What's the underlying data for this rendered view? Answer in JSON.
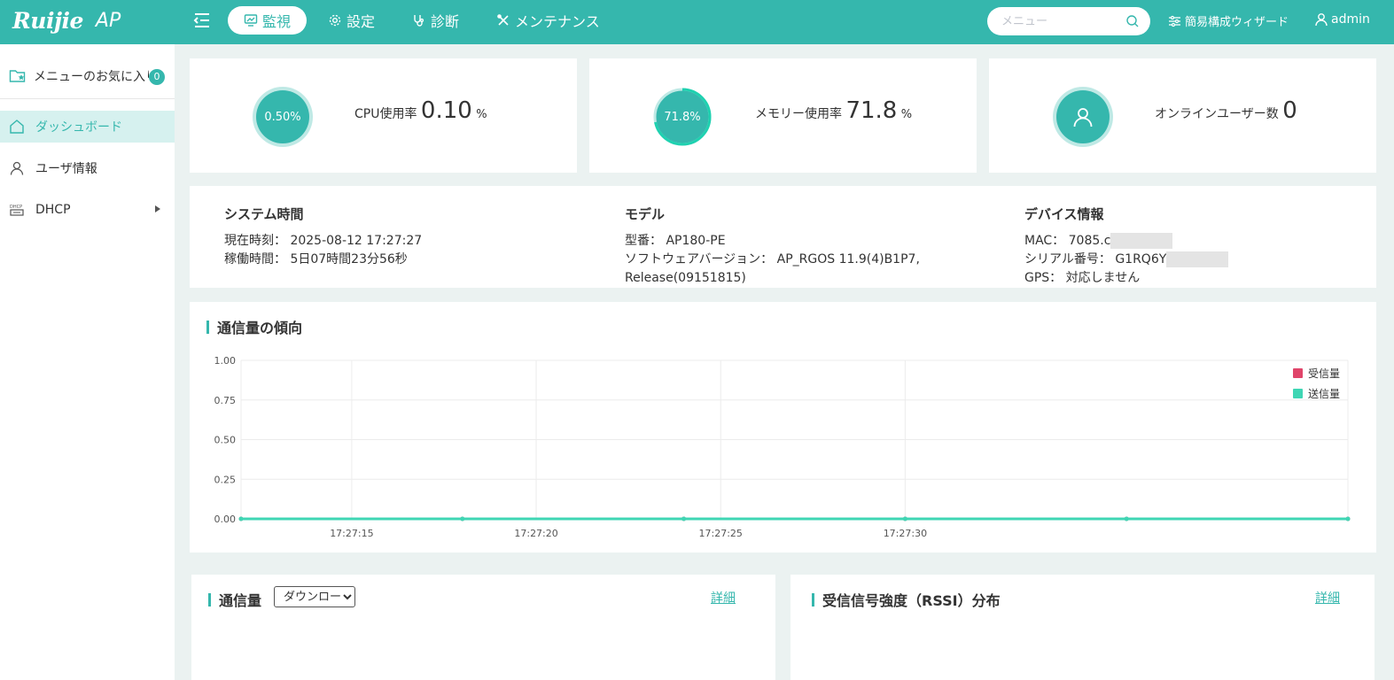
{
  "header": {
    "logo": "Ruijie",
    "product": "AP",
    "nav": [
      {
        "label": "監視",
        "icon": "monitor-icon",
        "active": true
      },
      {
        "label": "設定",
        "icon": "gear-icon",
        "active": false
      },
      {
        "label": "診断",
        "icon": "stethoscope-icon",
        "active": false
      },
      {
        "label": "メンテナンス",
        "icon": "tools-icon",
        "active": false
      }
    ],
    "search_placeholder": "メニュー",
    "wizard_label": "簡易構成ウィザード",
    "user_label": "admin"
  },
  "sidebar": {
    "favorites_label": "メニューのお気に入り",
    "favorites_count": "0",
    "items": [
      {
        "label": "ダッシュボード",
        "icon": "home-icon",
        "active": true
      },
      {
        "label": "ユーザ情報",
        "icon": "user-icon",
        "active": false
      },
      {
        "label": "DHCP",
        "icon": "dhcp-icon",
        "active": false
      }
    ]
  },
  "stats": {
    "cpu": {
      "circle": "0.50%",
      "label": "CPU使用率",
      "value": "0.10",
      "unit": "%"
    },
    "memory": {
      "circle": "71.8%",
      "label": "メモリー使用率",
      "value": "71.8",
      "unit": "%",
      "fraction": 0.718
    },
    "online": {
      "label": "オンラインユーザー数",
      "value": "0"
    }
  },
  "info": {
    "system": {
      "title": "システム時間",
      "current_label": "現在時刻：",
      "current_value": "2025-08-12 17:27:27",
      "uptime_label": "稼働時間：",
      "uptime_value": "5日07時間23分56秒"
    },
    "model": {
      "title": "モデル",
      "model_label": "型番：",
      "model_value": "AP180-PE",
      "sw_label": "ソフトウェアバージョン：",
      "sw_value": "AP_RGOS 11.9(4)B1P7,",
      "sw_value2": "Release(09151815)"
    },
    "device": {
      "title": "デバイス情報",
      "mac_label": "MAC：",
      "mac_value": "7085.c",
      "serial_label": "シリアル番号：",
      "serial_value": "G1RQ6Y",
      "gps_label": "GPS：",
      "gps_value": "対応しません"
    }
  },
  "traffic_trend": {
    "title": "通信量の傾向"
  },
  "chart_data": {
    "type": "line",
    "x": [
      "17:27:12",
      "17:27:18",
      "17:27:24",
      "17:27:30",
      "17:27:36",
      "17:27:42"
    ],
    "xticks": [
      "17:27:15",
      "17:27:20",
      "17:27:25",
      "17:27:30"
    ],
    "yticks": [
      "1.00",
      "0.75",
      "0.50",
      "0.25",
      "0.00"
    ],
    "ylim": [
      0,
      1
    ],
    "series": [
      {
        "name": "受信量",
        "color": "#e0456a",
        "values": [
          0,
          0,
          0,
          0,
          0,
          0
        ]
      },
      {
        "name": "送信量",
        "color": "#3fd6b4",
        "values": [
          0,
          0,
          0,
          0,
          0,
          0
        ]
      }
    ],
    "grid": true,
    "legend": "top-right"
  },
  "traffic": {
    "title": "通信量",
    "select_value": "ダウンロード",
    "detail": "詳細"
  },
  "rssi": {
    "title": "受信信号強度（RSSI）分布",
    "detail": "詳細"
  }
}
